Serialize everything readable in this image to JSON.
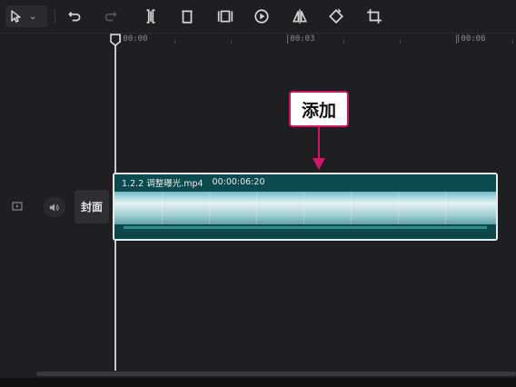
{
  "toolbar": {
    "tools": [
      {
        "name": "select-icon"
      },
      {
        "name": "undo-icon"
      },
      {
        "name": "redo-icon"
      },
      {
        "name": "split-icon"
      },
      {
        "name": "delete-icon"
      },
      {
        "name": "freeze-frame-icon"
      },
      {
        "name": "play-icon"
      },
      {
        "name": "mirror-icon"
      },
      {
        "name": "rotate-icon"
      },
      {
        "name": "crop-icon"
      }
    ]
  },
  "ruler": {
    "labels": [
      "|00:00",
      "|00:03",
      "|00:06"
    ]
  },
  "track": {
    "cover_label": "封面"
  },
  "clip": {
    "name": "1.2.2  调整曝光.mp4",
    "duration": "00:00:06:20"
  },
  "annotation": {
    "text": "添加",
    "color": "#d0156b"
  }
}
